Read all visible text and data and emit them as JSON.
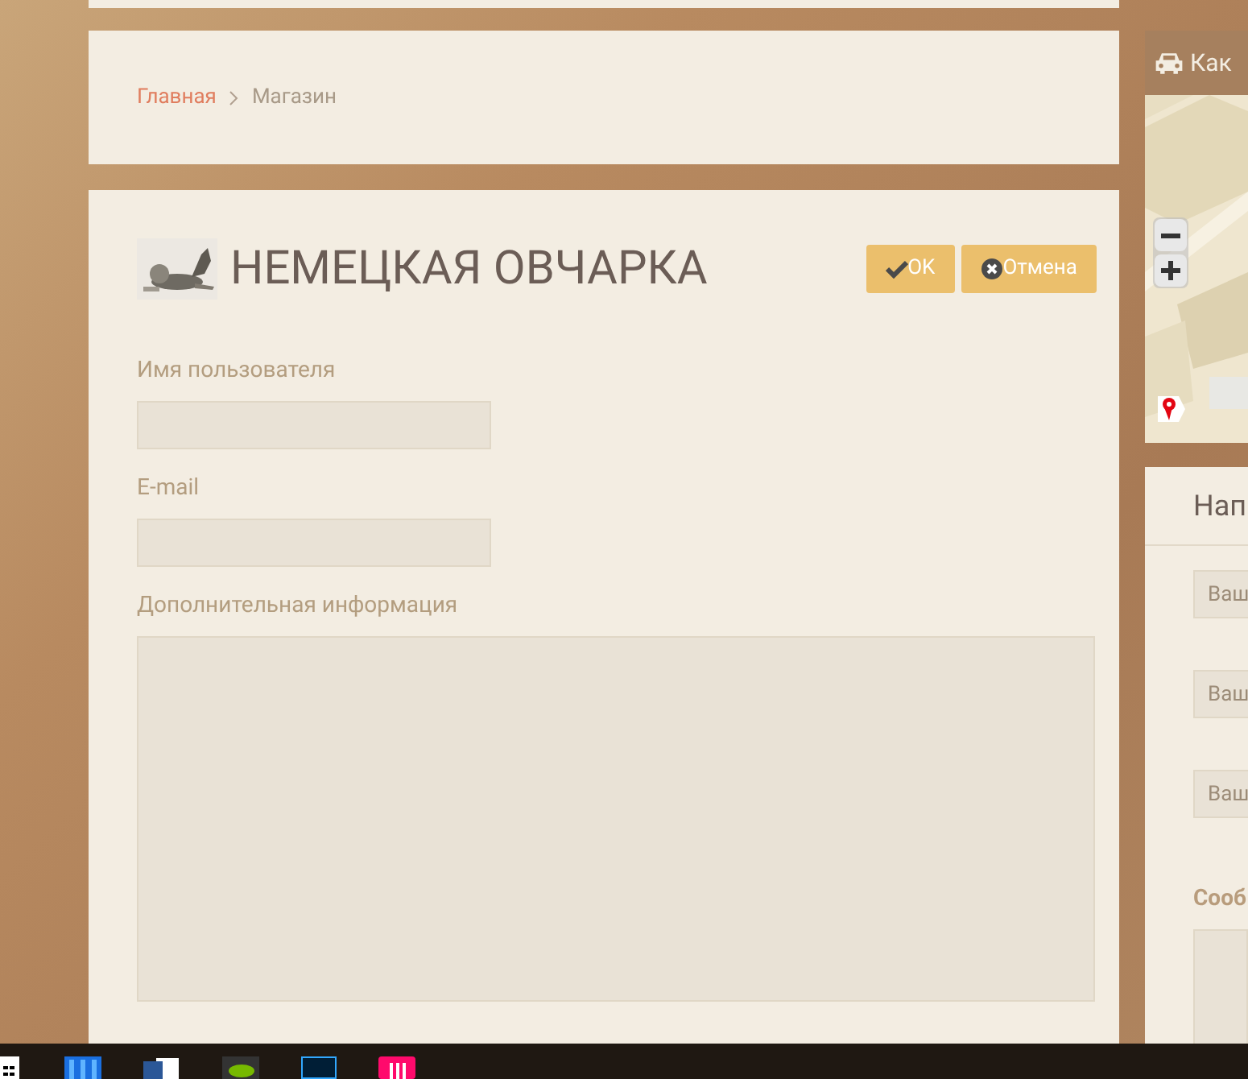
{
  "breadcrumb": [
    {
      "label": "Главная",
      "selected": false
    },
    {
      "label": "Магазин",
      "selected": true
    }
  ],
  "product": {
    "title": "НЕМЕЦКАЯ ОВЧАРКА"
  },
  "buttons": [
    {
      "label": "OK",
      "kind": "ok"
    },
    {
      "label": "Отмена",
      "kind": "cancel"
    }
  ],
  "form": [
    {
      "label": "Имя пользователя",
      "kind": "input"
    },
    {
      "label": "E-mail",
      "kind": "input"
    },
    {
      "label": "Дополнительная информация",
      "kind": "textarea"
    }
  ],
  "map_panel": {
    "title": "Как"
  },
  "contact_panel": {
    "title": "Нап",
    "fields": [
      {
        "placeholder": "Ваш"
      },
      {
        "placeholder": "Ваш"
      },
      {
        "placeholder": "Ваш"
      }
    ],
    "message_label": "Сооб"
  }
}
